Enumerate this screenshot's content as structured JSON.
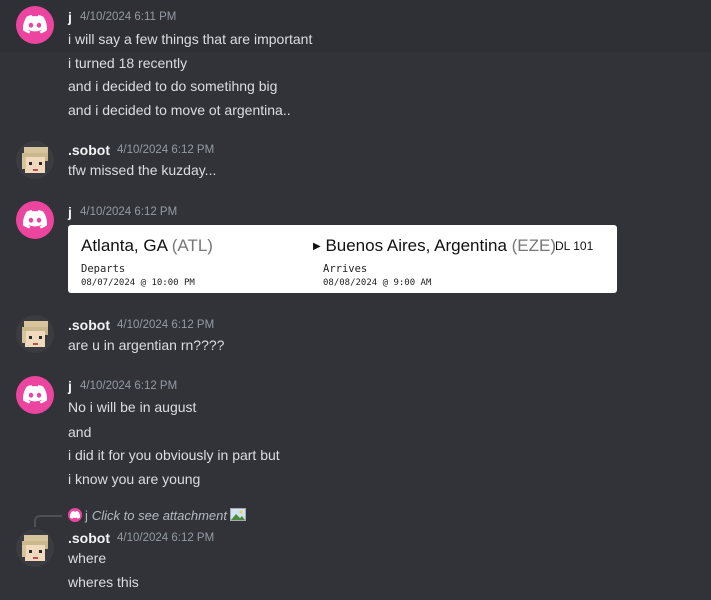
{
  "messages": [
    {
      "author": "j",
      "timestamp": "4/10/2024 6:11 PM",
      "lines": [
        "i will say a few things that are important",
        "i turned 18 recently",
        "and i decided to do sometihng big",
        "and i decided to move ot argentina.."
      ]
    },
    {
      "author": ".sobot",
      "timestamp": "4/10/2024 6:12 PM",
      "lines": [
        "tfw missed the kuzday..."
      ]
    },
    {
      "author": "j",
      "timestamp": "4/10/2024 6:12 PM",
      "embed": {
        "origin_city": "Atlanta, GA",
        "origin_code": "(ATL)",
        "dest_city": "Buenos Aires, Argentina",
        "dest_code": "(EZE)",
        "flight": "DL 101",
        "departs_label": "Departs",
        "departs_time": "08/07/2024 @ 10:00 PM",
        "arrives_label": "Arrives",
        "arrives_time": "08/08/2024 @ 9:00 AM"
      }
    },
    {
      "author": ".sobot",
      "timestamp": "4/10/2024 6:12 PM",
      "lines": [
        "are u in argentian rn????"
      ]
    },
    {
      "author": "j",
      "timestamp": "4/10/2024 6:12 PM",
      "lines": [
        "No i will be in august",
        "and",
        "i did it for you obviously in part but",
        "i know you are young"
      ]
    },
    {
      "author": ".sobot",
      "timestamp": "4/10/2024 6:12 PM",
      "reply": {
        "author": "j",
        "text": "Click to see attachment"
      },
      "lines": [
        "where",
        "wheres this"
      ]
    }
  ],
  "icons": {
    "discord_avatar": "discord-logo-icon",
    "sobot_avatar": "pixel-avatar-icon",
    "attachment": "image-icon"
  },
  "colors": {
    "background": "#313338",
    "discord_pink": "#eb459f",
    "username": "#f2f3f5",
    "timestamp": "#949ba4"
  }
}
